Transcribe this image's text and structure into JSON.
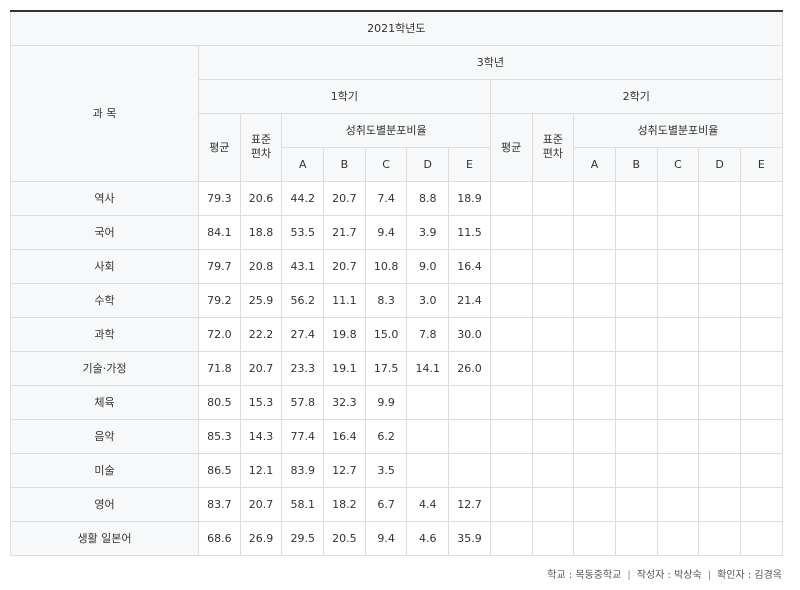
{
  "table": {
    "year_label": "2021학년도",
    "subject_header": "과 목",
    "grade_label": "3학년",
    "semesters": [
      "1학기",
      "2학기"
    ],
    "avg_label": "평균",
    "std_label_line1": "표준",
    "std_label_line2": "편차",
    "dist_label": "성취도별분포비율",
    "grades": [
      "A",
      "B",
      "C",
      "D",
      "E"
    ],
    "rows": [
      {
        "subject": "역사",
        "s1": [
          "79.3",
          "20.6",
          "44.2",
          "20.7",
          "7.4",
          "8.8",
          "18.9"
        ]
      },
      {
        "subject": "국어",
        "s1": [
          "84.1",
          "18.8",
          "53.5",
          "21.7",
          "9.4",
          "3.9",
          "11.5"
        ]
      },
      {
        "subject": "사회",
        "s1": [
          "79.7",
          "20.8",
          "43.1",
          "20.7",
          "10.8",
          "9.0",
          "16.4"
        ]
      },
      {
        "subject": "수학",
        "s1": [
          "79.2",
          "25.9",
          "56.2",
          "11.1",
          "8.3",
          "3.0",
          "21.4"
        ]
      },
      {
        "subject": "과학",
        "s1": [
          "72.0",
          "22.2",
          "27.4",
          "19.8",
          "15.0",
          "7.8",
          "30.0"
        ]
      },
      {
        "subject": "기술·가정",
        "s1": [
          "71.8",
          "20.7",
          "23.3",
          "19.1",
          "17.5",
          "14.1",
          "26.0"
        ]
      },
      {
        "subject": "체육",
        "s1": [
          "80.5",
          "15.3",
          "57.8",
          "32.3",
          "9.9",
          "",
          ""
        ]
      },
      {
        "subject": "음악",
        "s1": [
          "85.3",
          "14.3",
          "77.4",
          "16.4",
          "6.2",
          "",
          ""
        ]
      },
      {
        "subject": "미술",
        "s1": [
          "86.5",
          "12.1",
          "83.9",
          "12.7",
          "3.5",
          "",
          ""
        ]
      },
      {
        "subject": "영어",
        "s1": [
          "83.7",
          "20.7",
          "58.1",
          "18.2",
          "6.7",
          "4.4",
          "12.7"
        ]
      },
      {
        "subject": "생활 일본어",
        "s1": [
          "68.6",
          "26.9",
          "29.5",
          "20.5",
          "9.4",
          "4.6",
          "35.9"
        ]
      }
    ]
  },
  "footer": {
    "school": "학교 : 목동중학교",
    "writer": "작성자 : 박상숙",
    "checker": "확인자 : 김경옥",
    "separator": "|"
  }
}
